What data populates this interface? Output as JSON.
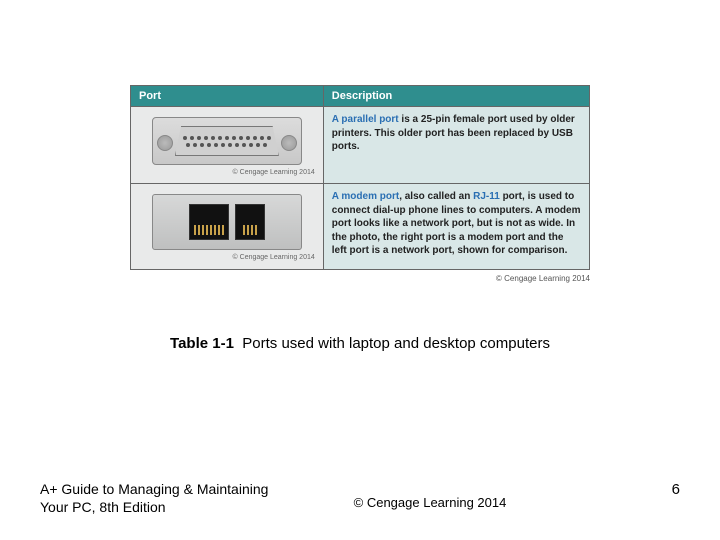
{
  "table": {
    "headers": {
      "port": "Port",
      "description": "Description"
    },
    "rows": [
      {
        "credit": "© Cengage Learning 2014",
        "term": "A parallel port",
        "rest": " is a 25-pin female port used by older printers. This older port has been replaced by USB ports."
      },
      {
        "credit": "© Cengage Learning 2014",
        "term": "A modem port",
        "mid": ", also called an ",
        "term2": "RJ-11",
        "rest": " port, is used to connect dial-up phone lines to computers. A modem port looks like a network port, but is not as wide. In the photo, the right port is a modem port and the left port is a network port, shown for comparison."
      }
    ],
    "outer_credit": "© Cengage Learning 2014"
  },
  "caption": {
    "label": "Table 1-1",
    "text": "Ports used with laptop and desktop computers"
  },
  "footer": {
    "book_line1": "A+ Guide to Managing & Maintaining",
    "book_line2": "Your PC, 8th Edition",
    "copyright": "© Cengage Learning 2014",
    "page": "6"
  }
}
